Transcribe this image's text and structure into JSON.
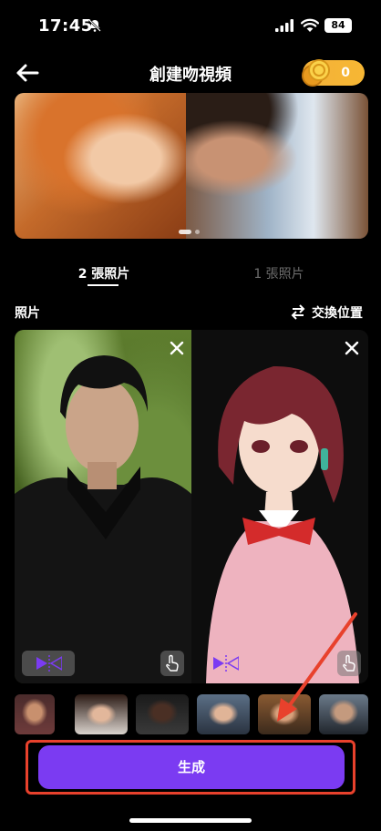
{
  "status_bar": {
    "time": "17:45",
    "battery": "84"
  },
  "header": {
    "title": "創建吻視頻",
    "coins": "0"
  },
  "tabs": [
    {
      "label": "2 張照片",
      "active": true
    },
    {
      "label": "1 張照片",
      "active": false
    }
  ],
  "photos_section": {
    "label": "照片",
    "swap_label": "交換位置"
  },
  "generate_button": {
    "label": "生成"
  },
  "colors": {
    "accent": "#7b3bf2",
    "highlight": "#e8412c",
    "coin": "#f3b23a"
  }
}
